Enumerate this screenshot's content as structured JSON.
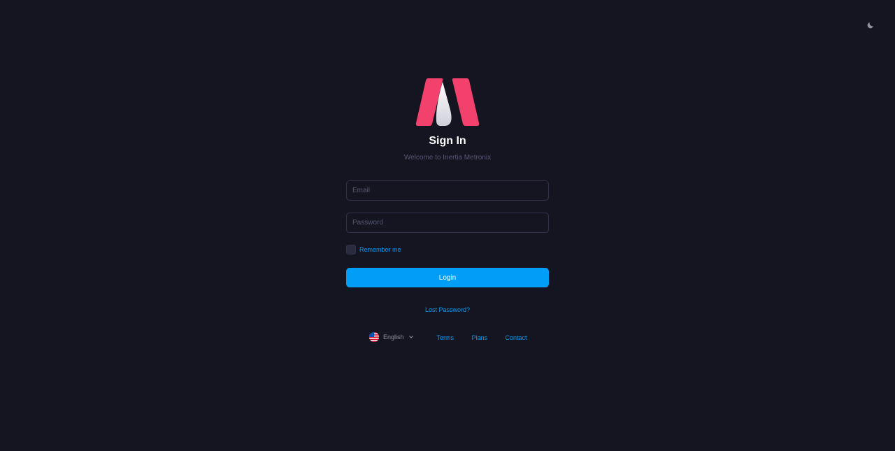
{
  "header": {
    "theme_icon": "moon-icon"
  },
  "brand": {
    "logo_icon": "metronic-logo-icon",
    "colors": {
      "primary": "#f1416c",
      "light": "#ffffff",
      "accent": "#009ef7"
    }
  },
  "signin": {
    "title": "Sign In",
    "subtitle": "Welcome to Inertia Metronix",
    "email_placeholder": "Email",
    "email_value": "",
    "password_placeholder": "Password",
    "password_value": "",
    "remember_label": "Remember me",
    "login_label": "Login",
    "lost_password": "Lost Password?"
  },
  "footer": {
    "language": {
      "label": "English",
      "flag_icon": "us-flag-icon",
      "chevron_icon": "chevron-down-icon"
    },
    "links": [
      "Terms",
      "Plans",
      "Contact"
    ]
  }
}
